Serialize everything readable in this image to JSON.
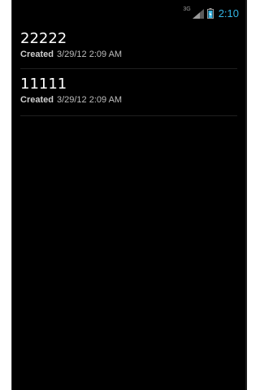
{
  "status_bar": {
    "network": "3G",
    "time": "2:10",
    "colors": {
      "clock": "#33b5e5",
      "battery": "#33b5e5"
    },
    "icons": [
      "signal-icon",
      "battery-icon"
    ]
  },
  "notes": [
    {
      "title": "22222",
      "created_label": "Created",
      "created_value": "3/29/12 2:09 AM"
    },
    {
      "title": "11111",
      "created_label": "Created",
      "created_value": "3/29/12 2:09 AM"
    }
  ]
}
